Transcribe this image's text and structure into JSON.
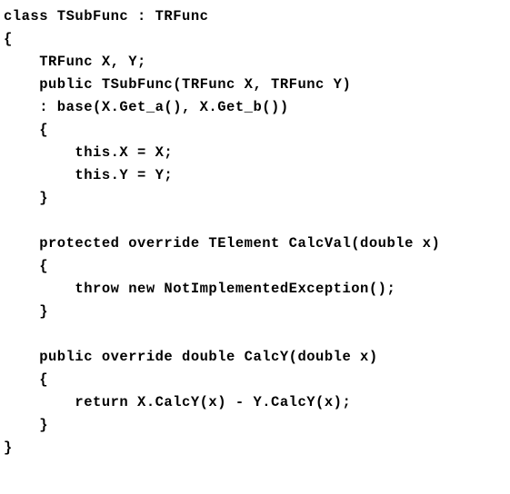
{
  "code": {
    "lines": [
      "class TSubFunc : TRFunc",
      "{",
      "    TRFunc X, Y;",
      "    public TSubFunc(TRFunc X, TRFunc Y)",
      "    : base(X.Get_a(), X.Get_b())",
      "    {",
      "        this.X = X;",
      "        this.Y = Y;",
      "    }",
      "",
      "    protected override TElement CalcVal(double x)",
      "    {",
      "        throw new NotImplementedException();",
      "    }",
      "",
      "    public override double CalcY(double x)",
      "    {",
      "        return X.CalcY(x) - Y.CalcY(x);",
      "    }",
      "}"
    ]
  }
}
